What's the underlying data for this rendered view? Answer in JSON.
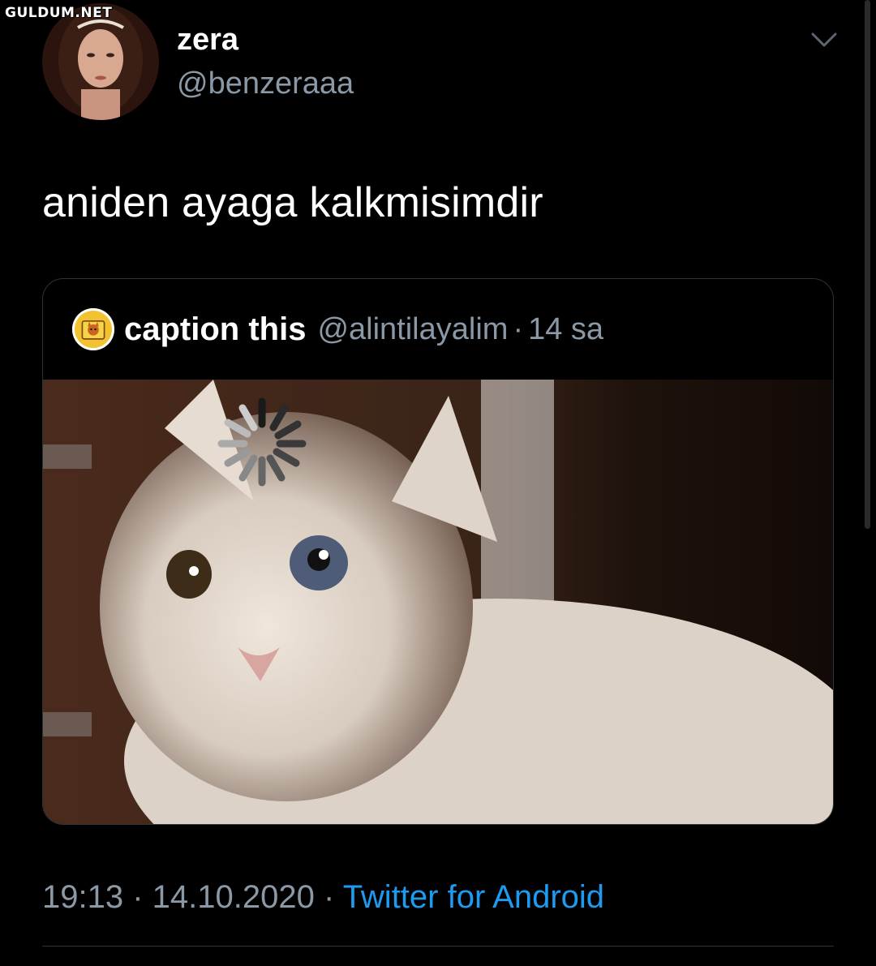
{
  "watermark": "GULDUM.NET",
  "author": {
    "display_name": "zera",
    "handle": "@benzeraaa"
  },
  "tweet": {
    "text": "aniden ayaga kalkmisimdir"
  },
  "quoted_tweet": {
    "display_name": "caption this",
    "handle": "@alintilayalim",
    "separator": "·",
    "relative_time": "14 sa"
  },
  "meta": {
    "time": "19:13",
    "sep1": " · ",
    "date": "14.10.2020",
    "sep2": " · ",
    "source": "Twitter for Android"
  },
  "icons": {
    "more": "chevron-down-icon",
    "loading": "loading-spinner-icon"
  },
  "colors": {
    "background": "#000000",
    "secondary_text": "#8b98a5",
    "link": "#1d9bf0",
    "border": "#2f3336"
  }
}
